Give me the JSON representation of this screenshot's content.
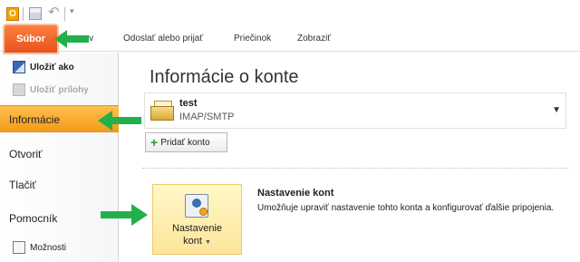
{
  "ribbon": {
    "file_tab": "Súbor",
    "tabs": [
      "nov",
      "Odoslať alebo prijať",
      "Priečinok",
      "Zobraziť"
    ]
  },
  "qat": {
    "app_icon_glyph": "O"
  },
  "left_nav": {
    "save_as": "Uložiť ako",
    "save_attachments": "Uložiť prílohy",
    "items": [
      "Informácie",
      "Otvoriť",
      "Tlačiť",
      "Pomocník"
    ],
    "options": "Možnosti",
    "selected_index": 0
  },
  "main": {
    "title": "Informácie o konte",
    "account": {
      "name": "test",
      "type": "IMAP/SMTP"
    },
    "add_account_label": "Pridať konto",
    "settings_tile": {
      "line1": "Nastavenie",
      "line2": "kont"
    },
    "section_title": "Nastavenie kont",
    "section_description": "Umožňuje upraviť nastavenie tohto konta a konfigurovať ďalšie pripojenia."
  },
  "colors": {
    "accent_orange": "#f39b1a",
    "file_tab": "#e8531c",
    "annotation_arrow": "#22b04b"
  },
  "icons": [
    "office-app-icon",
    "save-icon",
    "undo-icon",
    "save-as-icon",
    "attachments-icon",
    "options-icon",
    "account-icon",
    "plus-icon",
    "account-settings-icon",
    "dropdown-arrow-icon"
  ]
}
